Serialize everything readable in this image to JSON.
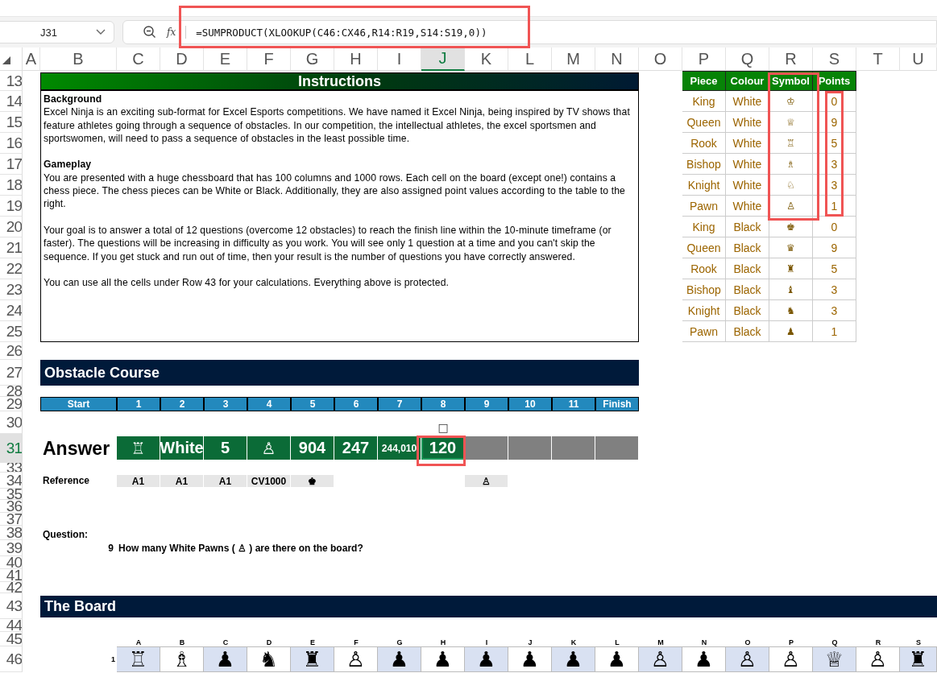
{
  "formula_bar": {
    "name_box": "J31",
    "function_label": "fx",
    "formula": "=SUMPRODUCT(XLOOKUP(C46:CX46,R14:R19,S14:S19,0))"
  },
  "column_headers": [
    {
      "label": "A",
      "selected": false
    },
    {
      "label": "B",
      "selected": false
    },
    {
      "label": "C",
      "selected": false
    },
    {
      "label": "D",
      "selected": false
    },
    {
      "label": "E",
      "selected": false
    },
    {
      "label": "F",
      "selected": false
    },
    {
      "label": "G",
      "selected": false
    },
    {
      "label": "H",
      "selected": false
    },
    {
      "label": "I",
      "selected": false
    },
    {
      "label": "J",
      "selected": true
    },
    {
      "label": "K",
      "selected": false
    },
    {
      "label": "L",
      "selected": false
    },
    {
      "label": "M",
      "selected": false
    },
    {
      "label": "N",
      "selected": false
    },
    {
      "label": "O",
      "selected": false
    },
    {
      "label": "P",
      "selected": false
    },
    {
      "label": "Q",
      "selected": false
    },
    {
      "label": "R",
      "selected": false
    },
    {
      "label": "S",
      "selected": false
    },
    {
      "label": "T",
      "selected": false
    },
    {
      "label": "U",
      "selected": false
    }
  ],
  "row_headers": [
    {
      "label": "13",
      "selected": false
    },
    {
      "label": "14",
      "selected": false
    },
    {
      "label": "15",
      "selected": false
    },
    {
      "label": "16",
      "selected": false
    },
    {
      "label": "17",
      "selected": false
    },
    {
      "label": "18",
      "selected": false
    },
    {
      "label": "19",
      "selected": false
    },
    {
      "label": "20",
      "selected": false
    },
    {
      "label": "21",
      "selected": false
    },
    {
      "label": "22",
      "selected": false
    },
    {
      "label": "23",
      "selected": false
    },
    {
      "label": "24",
      "selected": false
    },
    {
      "label": "25",
      "selected": false
    },
    {
      "label": "26",
      "selected": false
    },
    {
      "label": "27",
      "selected": false
    },
    {
      "label": "28",
      "selected": false
    },
    {
      "label": "29",
      "selected": false
    },
    {
      "label": "30",
      "selected": false
    },
    {
      "label": "31",
      "selected": true
    },
    {
      "label": "33",
      "selected": false
    },
    {
      "label": "34",
      "selected": false
    },
    {
      "label": "35",
      "selected": false
    },
    {
      "label": "36",
      "selected": false
    },
    {
      "label": "37",
      "selected": false
    },
    {
      "label": "38",
      "selected": false
    },
    {
      "label": "39",
      "selected": false
    },
    {
      "label": "40",
      "selected": false
    },
    {
      "label": "41",
      "selected": false
    },
    {
      "label": "42",
      "selected": false
    },
    {
      "label": "43",
      "selected": false
    },
    {
      "label": "44",
      "selected": false
    },
    {
      "label": "45",
      "selected": false
    },
    {
      "label": "46",
      "selected": false
    }
  ],
  "instructions": {
    "title": "Instructions",
    "sections": [
      {
        "heading": "Background",
        "paragraphs": [
          "Excel Ninja is an exciting sub-format for Excel Esports competitions. We have named it Excel Ninja, being inspired by TV shows that feature athletes going through a sequence of obstacles. In our competition, the intellectual athletes, the excel sportsmen and sportswomen, will need to pass a sequence of obstacles in the least possible time."
        ]
      },
      {
        "heading": "Gameplay",
        "paragraphs": [
          "You are presented with a huge chessboard that has 100 columns and 1000 rows. Each cell on the board (except one!) contains a chess piece. The chess pieces can be White or Black. Additionally, they are also assigned point values according to the table to the right.",
          "Your goal is to answer a total of 12 questions (overcome 12 obstacles) to reach the finish line within the 10-minute timeframe (or faster). The questions will be increasing in difficulty as you work. You will see only 1 question at a time and you can't skip the sequence. If you get stuck and run out of time, then your result is the number of questions you have correctly answered.",
          "You can use all the cells under Row 43 for your calculations. Everything above is protected."
        ]
      }
    ]
  },
  "pieces_table": {
    "columns": [
      "Piece",
      "Colour",
      "Symbol",
      "Points"
    ],
    "rows": [
      [
        "King",
        "White",
        "♔",
        "0"
      ],
      [
        "Queen",
        "White",
        "♕",
        "9"
      ],
      [
        "Rook",
        "White",
        "♖",
        "5"
      ],
      [
        "Bishop",
        "White",
        "♗",
        "3"
      ],
      [
        "Knight",
        "White",
        "♘",
        "3"
      ],
      [
        "Pawn",
        "White",
        "♙",
        "1"
      ],
      [
        "King",
        "Black",
        "♚",
        "0"
      ],
      [
        "Queen",
        "Black",
        "♛",
        "9"
      ],
      [
        "Rook",
        "Black",
        "♜",
        "5"
      ],
      [
        "Bishop",
        "Black",
        "♝",
        "3"
      ],
      [
        "Knight",
        "Black",
        "♞",
        "3"
      ],
      [
        "Pawn",
        "Black",
        "♟",
        "1"
      ]
    ]
  },
  "obstacle_course": {
    "title": "Obstacle Course",
    "stages": [
      "Start",
      "1",
      "2",
      "3",
      "4",
      "5",
      "6",
      "7",
      "8",
      "9",
      "10",
      "11",
      "Finish"
    ],
    "marker": "□",
    "answer_label": "Answer",
    "answers": [
      {
        "text": "♖",
        "answered": true,
        "selected": false,
        "reference": "A1"
      },
      {
        "text": "White",
        "answered": true,
        "selected": false,
        "reference": "A1"
      },
      {
        "text": "5",
        "answered": true,
        "selected": false,
        "reference": "A1"
      },
      {
        "text": "♙",
        "answered": true,
        "selected": false,
        "reference": "CV1000"
      },
      {
        "text": "904",
        "answered": true,
        "selected": false,
        "reference": "♚"
      },
      {
        "text": "247",
        "answered": true,
        "selected": false
      },
      {
        "text": "244,010",
        "answered": true,
        "selected": false
      },
      {
        "text": "120",
        "answered": true,
        "selected": true
      },
      {
        "answered": false,
        "selected": false,
        "reference": "♙"
      },
      {
        "answered": false,
        "selected": false
      },
      {
        "answered": false,
        "selected": false
      },
      {
        "answered": false,
        "selected": false
      }
    ],
    "reference_label": "Reference"
  },
  "question": {
    "label": "Question:",
    "number": "9",
    "text": "How many White Pawns ( ♙ ) are there on the board?"
  },
  "board": {
    "title": "The Board",
    "columns": [
      "A",
      "B",
      "C",
      "D",
      "E",
      "F",
      "G",
      "H",
      "I",
      "J",
      "K",
      "L",
      "M",
      "N",
      "O",
      "P",
      "Q",
      "R",
      "S"
    ],
    "rows": [
      {
        "label": "1",
        "cells": [
          {
            "piece": "♖",
            "shaded": true
          },
          {
            "piece": "♗",
            "shaded": false
          },
          {
            "piece": "♟",
            "shaded": true
          },
          {
            "piece": "♞",
            "shaded": false
          },
          {
            "piece": "♜",
            "shaded": true
          },
          {
            "piece": "♙",
            "shaded": false
          },
          {
            "piece": "♟",
            "shaded": true
          },
          {
            "piece": "♟",
            "shaded": false
          },
          {
            "piece": "♟",
            "shaded": true
          },
          {
            "piece": "♟",
            "shaded": false
          },
          {
            "piece": "♟",
            "shaded": true
          },
          {
            "piece": "♟",
            "shaded": false
          },
          {
            "piece": "♙",
            "shaded": true
          },
          {
            "piece": "♟",
            "shaded": false
          },
          {
            "piece": "♙",
            "shaded": true
          },
          {
            "piece": "♙",
            "shaded": false
          },
          {
            "piece": "♕",
            "shaded": true
          },
          {
            "piece": "♙",
            "shaded": false
          },
          {
            "piece": "♜",
            "shaded": true
          }
        ]
      }
    ]
  }
}
